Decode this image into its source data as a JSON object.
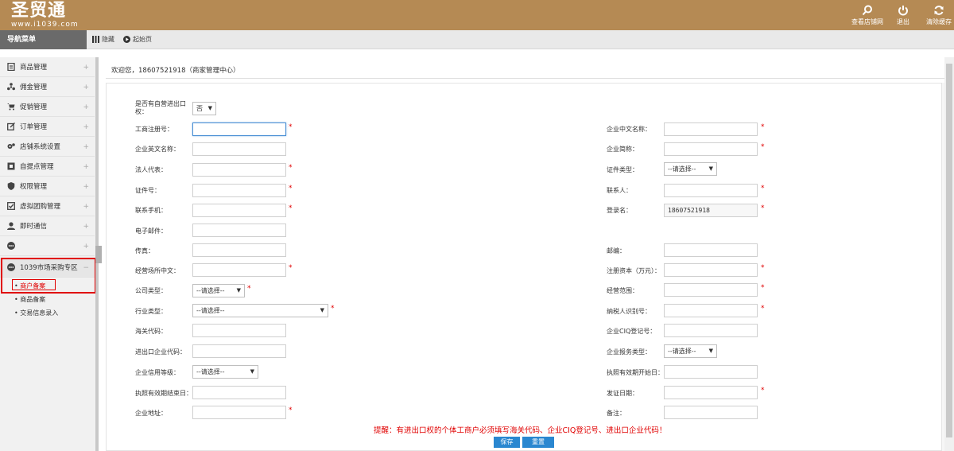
{
  "header": {
    "logo_text": "圣贸通",
    "logo_sub": "www.i1039.com",
    "buttons": [
      {
        "label": "查看店铺网",
        "icon": "search-icon"
      },
      {
        "label": "退出",
        "icon": "power-icon"
      },
      {
        "label": "清除缓存",
        "icon": "refresh-icon"
      }
    ]
  },
  "subbar": {
    "nav_title": "导航菜单",
    "hide_label": "隐藏",
    "home_label": "起始页"
  },
  "sidebar": {
    "items": [
      {
        "label": "商品管理",
        "icon": "goods-icon"
      },
      {
        "label": "佣金管理",
        "icon": "commission-icon"
      },
      {
        "label": "促销管理",
        "icon": "cart-icon"
      },
      {
        "label": "订单管理",
        "icon": "order-icon"
      },
      {
        "label": "店铺系统设置",
        "icon": "settings-icon"
      },
      {
        "label": "自提点管理",
        "icon": "pickup-icon"
      },
      {
        "label": "权限管理",
        "icon": "shield-icon"
      },
      {
        "label": "虚拟团购管理",
        "icon": "checkbox-icon"
      },
      {
        "label": "即时通信",
        "icon": "user-chat-icon"
      },
      {
        "label": "",
        "icon": "more-icon"
      },
      {
        "label": "1039市场采购专区",
        "icon": "more-icon"
      }
    ],
    "plus": "+",
    "minus": "−",
    "subitems": [
      "商户备案",
      "商品备案",
      "交易信息录入"
    ]
  },
  "welcome": "欢迎您，18607521918（商家管理中心）",
  "form": {
    "self_export_label": "是否有自营进出口权：",
    "self_export_value": "否",
    "fields_left": [
      {
        "label": "工商注册号：",
        "value": "",
        "required": true
      },
      {
        "label": "企业英文名称：",
        "value": "",
        "required": false
      },
      {
        "label": "法人代表：",
        "value": "",
        "required": true
      },
      {
        "label": "证件号：",
        "value": "",
        "required": true
      },
      {
        "label": "联系手机：",
        "value": "",
        "required": true
      },
      {
        "label": "电子邮件：",
        "value": "",
        "required": false
      },
      {
        "label": "传真：",
        "value": "",
        "required": false
      },
      {
        "label": "经营场所中文：",
        "value": "",
        "required": true
      },
      {
        "label": "公司类型：",
        "value": "--请选择--",
        "required": true,
        "type": "select"
      },
      {
        "label": "行业类型：",
        "value": "--请选择--",
        "required": true,
        "type": "select"
      },
      {
        "label": "海关代码：",
        "value": "",
        "required": false
      },
      {
        "label": "进出口企业代码：",
        "value": "",
        "required": false
      },
      {
        "label": "企业信用等级：",
        "value": "--请选择--",
        "required": false,
        "type": "select"
      },
      {
        "label": "执照有效期结束日：",
        "value": "",
        "required": false
      },
      {
        "label": "企业地址：",
        "value": "",
        "required": true
      }
    ],
    "fields_right": [
      {
        "label": "企业中文名称：",
        "value": "",
        "required": true
      },
      {
        "label": "企业简称：",
        "value": "",
        "required": true
      },
      {
        "label": "证件类型：",
        "value": "--请选择--",
        "required": false,
        "type": "select"
      },
      {
        "label": "联系人：",
        "value": "",
        "required": true
      },
      {
        "label": "登录名：",
        "value": "18607521918",
        "required": true
      },
      {
        "label": "邮编：",
        "value": "",
        "required": false
      },
      {
        "label": "注册资本（万元）：",
        "value": "",
        "required": true
      },
      {
        "label": "经营范围：",
        "value": "",
        "required": true
      },
      {
        "label": "纳税人识别号：",
        "value": "",
        "required": true
      },
      {
        "label": "企业CIQ登记号：",
        "value": "",
        "required": false
      },
      {
        "label": "企业报务类型：",
        "value": "--请选择--",
        "required": false,
        "type": "select"
      },
      {
        "label": "执照有效期开始日：",
        "value": "",
        "required": false
      },
      {
        "label": "发证日期：",
        "value": "",
        "required": true
      },
      {
        "label": "备注：",
        "value": "",
        "required": false
      }
    ],
    "required_mark": "*",
    "warning": "提醒：有进出口权的个体工商户必须填写海关代码、企业CIQ登记号、进出口企业代码！",
    "save_label": "保存",
    "reset_label": "重置"
  },
  "colors": {
    "topbar": "#b58a54",
    "accent": "#2a87d0",
    "warning": "#e00000"
  }
}
